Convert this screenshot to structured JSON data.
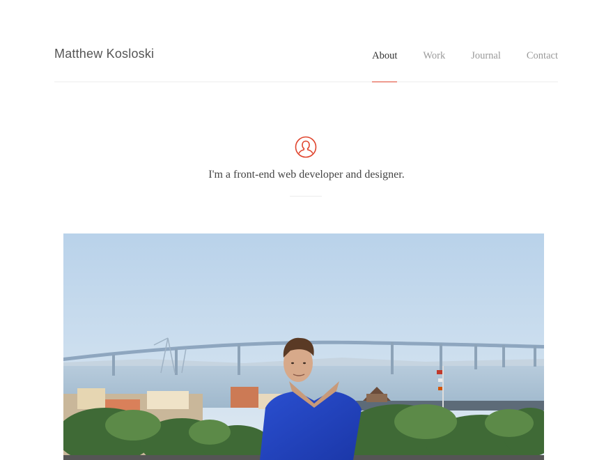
{
  "header": {
    "brand": "Matthew Kosloski",
    "nav": [
      {
        "label": "About",
        "active": true
      },
      {
        "label": "Work",
        "active": false
      },
      {
        "label": "Journal",
        "active": false
      },
      {
        "label": "Contact",
        "active": false
      }
    ]
  },
  "intro": {
    "icon": "user-icon",
    "tagline": "I'm a front-end web developer and designer."
  },
  "photo": {
    "subject": "portrait-photo"
  },
  "colors": {
    "accent": "#e0452e",
    "text": "#444444",
    "muted": "#9a9a9a",
    "divider": "#ececec"
  }
}
